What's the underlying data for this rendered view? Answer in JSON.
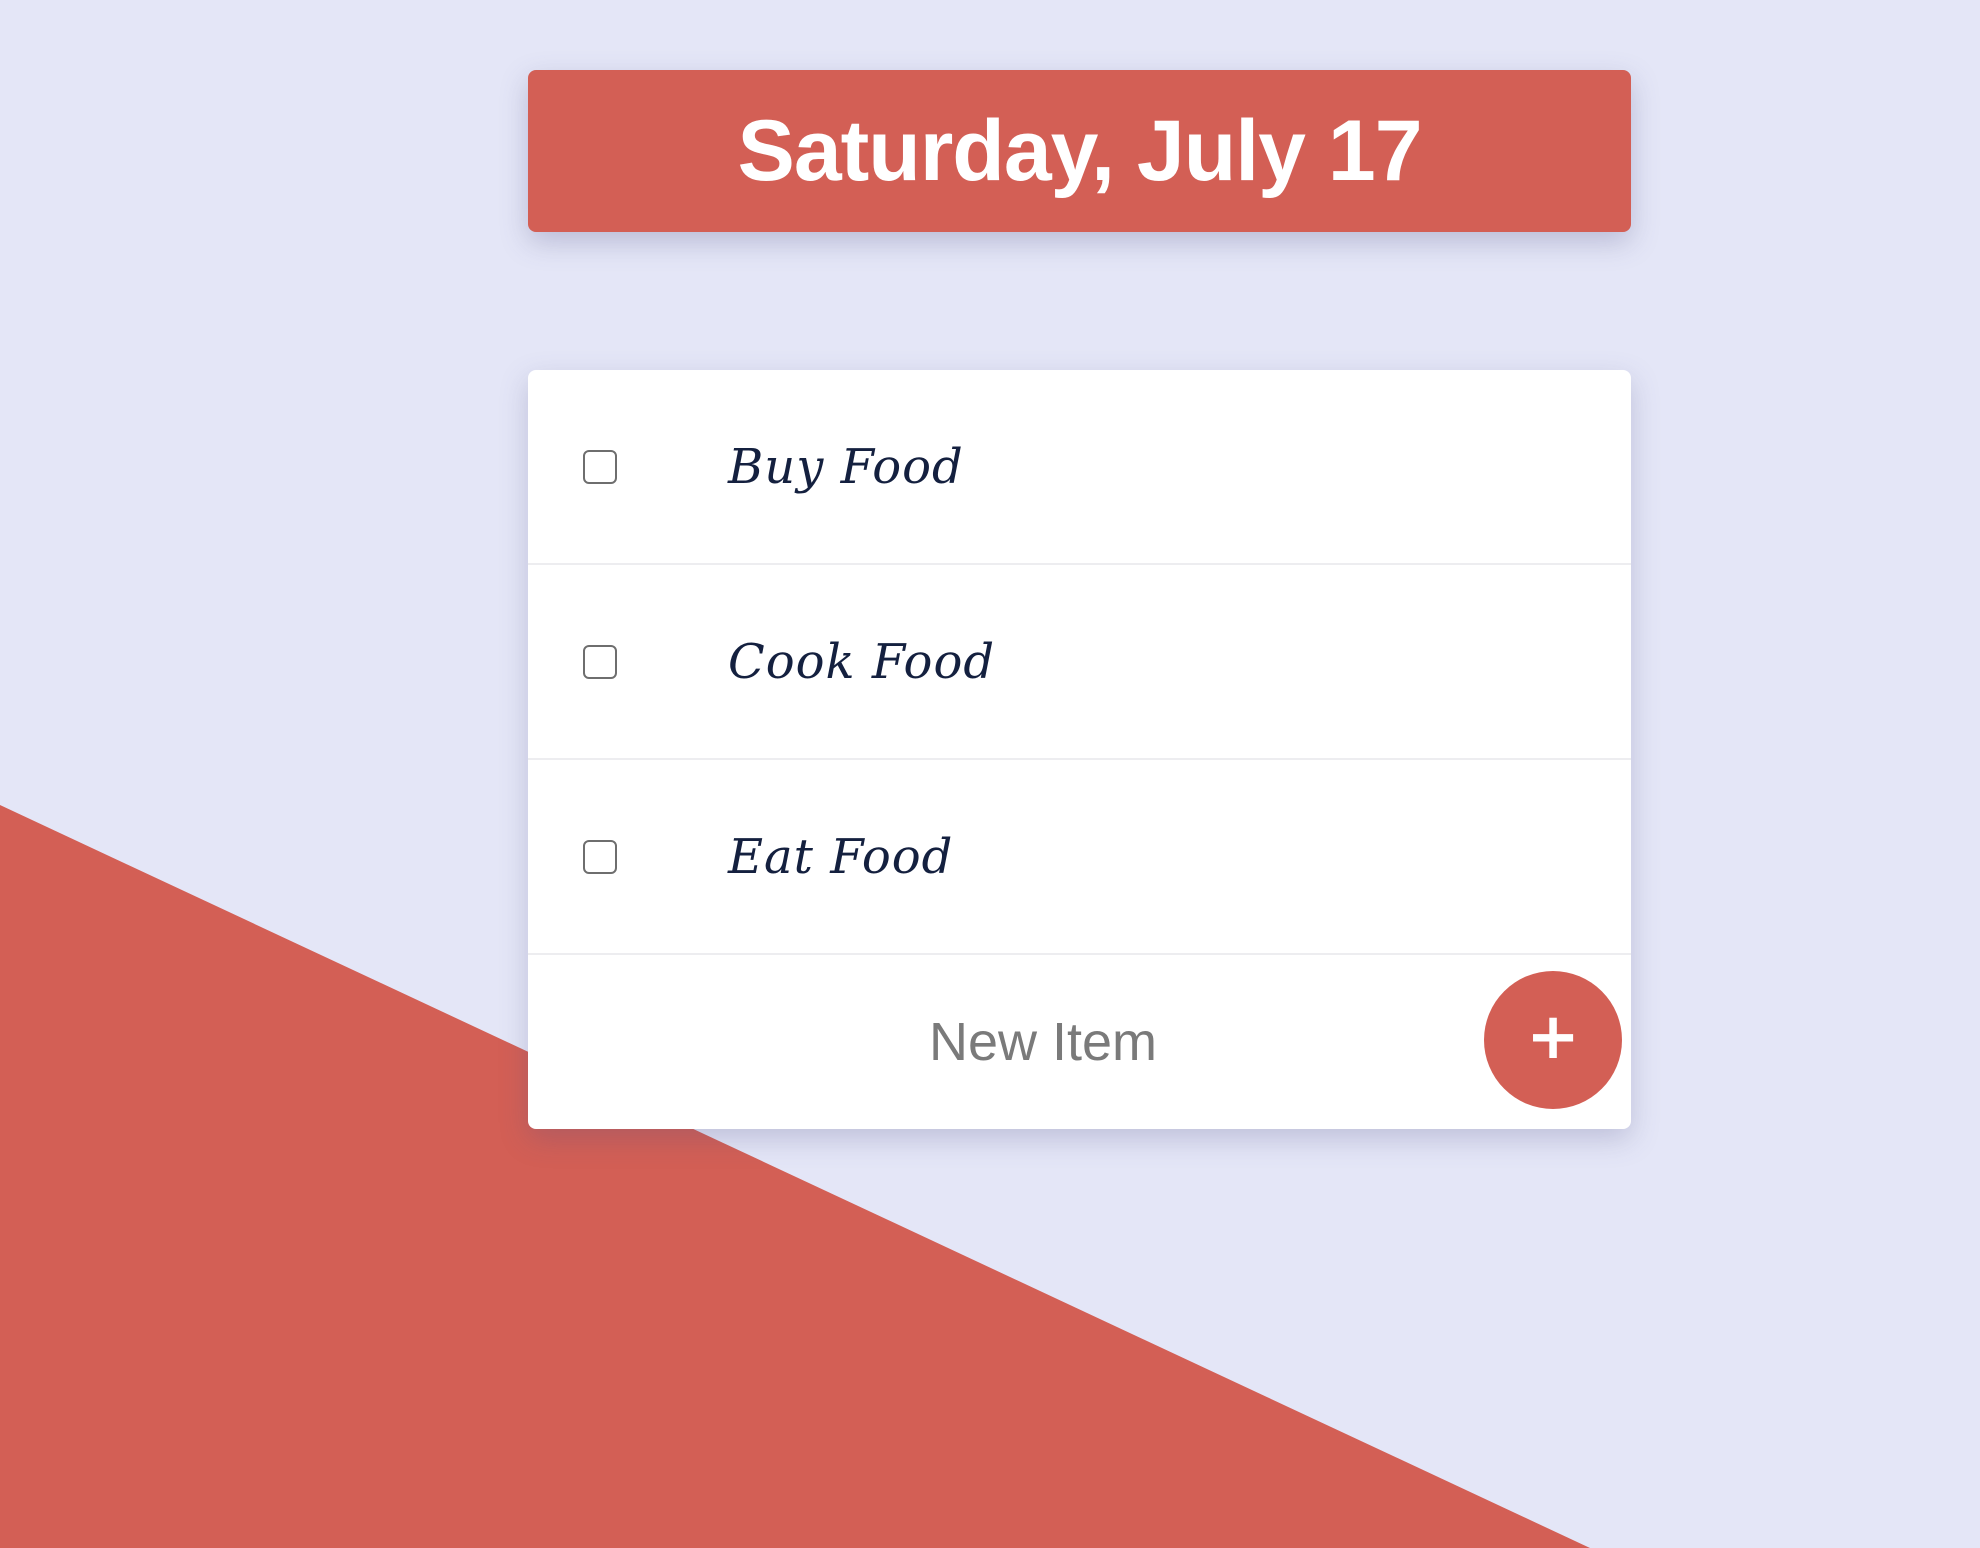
{
  "header": {
    "date_title": "Saturday, July 17"
  },
  "todo": {
    "items": [
      {
        "label": "Buy Food",
        "checked": false
      },
      {
        "label": "Cook Food",
        "checked": false
      },
      {
        "label": "Eat Food",
        "checked": false
      }
    ],
    "new_item": {
      "placeholder": "New Item",
      "value": ""
    },
    "add_button_icon": "plus-icon",
    "add_button_glyph": "+"
  },
  "colors": {
    "background": "#E4E6F7",
    "accent": "#D35F55",
    "card": "#FFFFFF",
    "item_text": "#14203F",
    "placeholder_text": "#7A7A7A"
  }
}
